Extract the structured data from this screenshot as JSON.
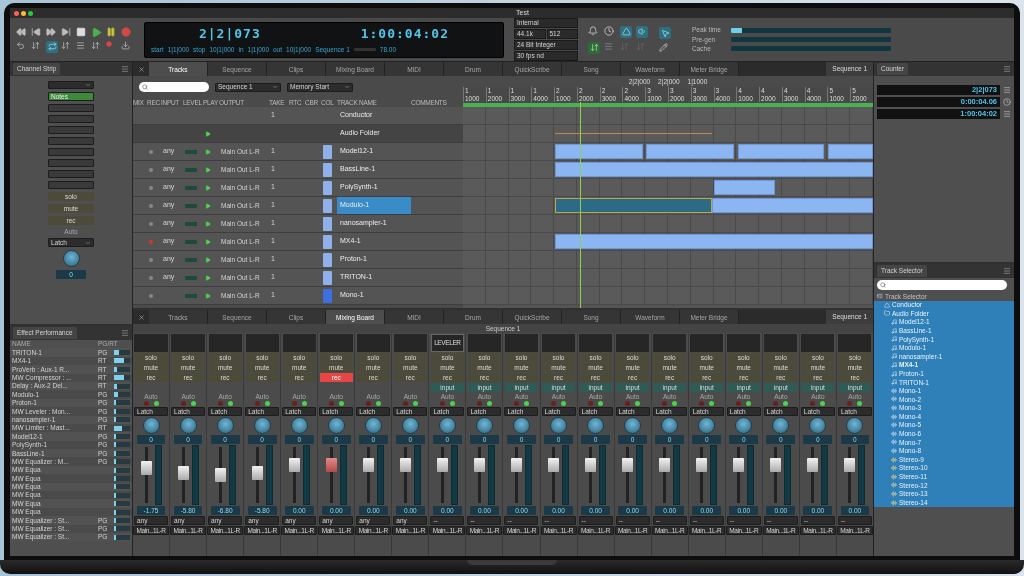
{
  "window": {
    "title": "Test"
  },
  "transport": {
    "position": "2|2|073",
    "timecode": "1:00:04:02",
    "markers": [
      {
        "label": "start",
        "value": "1|1|000"
      },
      {
        "label": "stop",
        "value": "10|1|000"
      },
      {
        "label": "in",
        "value": "1|1|000"
      },
      {
        "label": "out",
        "value": "10|1|000"
      }
    ],
    "sequence": "Sequence 1",
    "tempo": "78.00",
    "engine": [
      [
        "Internal"
      ],
      [
        "44.1k",
        "512"
      ],
      [
        "24 Bit Integer"
      ],
      [
        "30 fps nd"
      ]
    ]
  },
  "status_meters": [
    {
      "label": "Peak time",
      "level": 0.07
    },
    {
      "label": "Pre-gen",
      "level": 0
    },
    {
      "label": "Cache",
      "level": 0
    }
  ],
  "channel_strip": {
    "title": "Channel Strip",
    "notes": "Notes",
    "solo": "solo",
    "mute": "mute",
    "rec": "rec",
    "auto": "Auto",
    "mode": "Latch",
    "pan": "0"
  },
  "top_tabs": [
    {
      "label": "Tracks",
      "selected": true
    },
    {
      "label": "Sequence",
      "selected": false
    },
    {
      "label": "Clips",
      "selected": false
    },
    {
      "label": "Mixing Board",
      "selected": false
    },
    {
      "label": "MIDI",
      "selected": false
    },
    {
      "label": "Drum",
      "selected": false
    },
    {
      "label": "QuickScribe",
      "selected": false
    },
    {
      "label": "Song",
      "selected": false
    },
    {
      "label": "Waveform",
      "selected": false
    },
    {
      "label": "Meter Bridge",
      "selected": false
    }
  ],
  "top_sequence_menu": "Sequence 1",
  "tracks": {
    "sequence": "Sequence 1",
    "memory": "Memory Start",
    "columns": [
      "MIX",
      "REC",
      "INPUT",
      "LEVEL",
      "PLAY",
      "OUTPUT",
      "TAKE",
      "RTC",
      "CBR",
      "COL",
      "TRACK NAME",
      "COMMENTS"
    ],
    "rows": [
      {
        "kind": "conductor",
        "name": "Conductor",
        "take": "1",
        "selected": false
      },
      {
        "kind": "folder",
        "name": "Audio Folder",
        "selected": false
      },
      {
        "kind": "track",
        "name": "Model12-1",
        "input": "any",
        "output": "Main Out L-R",
        "take": "1",
        "rec": false,
        "color": "#8fb0e8",
        "selected": false
      },
      {
        "kind": "track",
        "name": "BassLine-1",
        "input": "any",
        "output": "Main Out L-R",
        "take": "1",
        "rec": false,
        "color": "#8fb0e8",
        "selected": false
      },
      {
        "kind": "track",
        "name": "PolySynth-1",
        "input": "any",
        "output": "Main Out L-R",
        "take": "1",
        "rec": false,
        "color": "#8fb0e8",
        "selected": false
      },
      {
        "kind": "track",
        "name": "Modulo-1",
        "input": "any",
        "output": "Main Out L-R",
        "take": "1",
        "rec": false,
        "color": "#8fb0e8",
        "selected": true
      },
      {
        "kind": "track",
        "name": "nanosampler-1",
        "input": "any",
        "output": "Main Out L-R",
        "take": "1",
        "rec": false,
        "color": "#8fb0e8",
        "selected": false
      },
      {
        "kind": "track",
        "name": "MX4-1",
        "input": "any",
        "output": "Main Out L-R",
        "take": "1",
        "rec": true,
        "color": "#8fb0e8",
        "selected": false
      },
      {
        "kind": "track",
        "name": "Proton-1",
        "input": "any",
        "output": "Main Out L-R",
        "take": "1",
        "rec": false,
        "color": "#8fb0e8",
        "selected": false
      },
      {
        "kind": "track",
        "name": "TRITON-1",
        "input": "any",
        "output": "Main Out L-R",
        "take": "1",
        "rec": false,
        "color": "#8fb0e8",
        "selected": false
      },
      {
        "kind": "track",
        "name": "Mono-1",
        "output": "Main Out L-R",
        "take": "1",
        "rec": false,
        "color": "#3d6fe0",
        "selected": false
      }
    ]
  },
  "timeline": {
    "readouts": [
      "2|2|000",
      "2|2|000",
      "1|1000"
    ],
    "ruler": [
      {
        "bar": "1",
        "tick": "1000"
      },
      {
        "bar": "1",
        "tick": "2000"
      },
      {
        "bar": "1",
        "tick": "3000"
      },
      {
        "bar": "1",
        "tick": "4000"
      },
      {
        "bar": "2",
        "tick": "1000"
      },
      {
        "bar": "2",
        "tick": "2000"
      },
      {
        "bar": "2",
        "tick": "3000"
      },
      {
        "bar": "2",
        "tick": "4000"
      },
      {
        "bar": "3",
        "tick": "1000"
      },
      {
        "bar": "3",
        "tick": "2000"
      },
      {
        "bar": "3",
        "tick": "3000"
      },
      {
        "bar": "3",
        "tick": "4000"
      },
      {
        "bar": "4",
        "tick": "1000"
      },
      {
        "bar": "4",
        "tick": "2000"
      },
      {
        "bar": "4",
        "tick": "3000"
      },
      {
        "bar": "4",
        "tick": "4000"
      },
      {
        "bar": "5",
        "tick": "1000"
      },
      {
        "bar": "5",
        "tick": "2000"
      }
    ]
  },
  "counter": {
    "title": "Counter",
    "readings": [
      "2|2|073",
      "0:00:04.06",
      "1:00:04:02"
    ]
  },
  "effects": {
    "title": "Effect Performance",
    "columns": [
      "NAME",
      "PG/RT"
    ],
    "rows": [
      {
        "name": "TRITON-1",
        "mode": "PG",
        "level": 0.3
      },
      {
        "name": "MX4-1",
        "mode": "RT",
        "level": 0.6
      },
      {
        "name": "ProVerb : Aux-1 R...",
        "mode": "RT",
        "level": 0.2
      },
      {
        "name": "MW Compressor : ...",
        "mode": "RT",
        "level": 0.6
      },
      {
        "name": "Delay : Aux-2 Del...",
        "mode": "RT",
        "level": 0.2
      },
      {
        "name": "Modulo-1",
        "mode": "PG",
        "level": 0.25
      },
      {
        "name": "Proton-1",
        "mode": "PG",
        "level": 0.15
      },
      {
        "name": "MW Leveler : Mon...",
        "mode": "PG",
        "level": 0.15
      },
      {
        "name": "nanosampler-1",
        "mode": "PG",
        "level": 0.15
      },
      {
        "name": "MW Limiter : Mast...",
        "mode": "RT",
        "level": 0.5
      },
      {
        "name": "Model12-1",
        "mode": "PG",
        "level": 0.15
      },
      {
        "name": "PolySynth-1",
        "mode": "PG",
        "level": 0.15
      },
      {
        "name": "BassLine-1",
        "mode": "PG",
        "level": 0.15
      },
      {
        "name": "MW Equalizer : M...",
        "mode": "PG",
        "level": 0.1
      },
      {
        "name": "MW Equa",
        "level": 0.1
      },
      {
        "name": "MW Equa",
        "level": 0.1
      },
      {
        "name": "MW Equa",
        "level": 0.1
      },
      {
        "name": "MW Equa",
        "level": 0.1
      },
      {
        "name": "MW Equa",
        "level": 0.1
      },
      {
        "name": "MW Equa",
        "level": 0.1
      },
      {
        "name": "MW Equalizer : St...",
        "mode": "PG",
        "level": 0.1
      },
      {
        "name": "MW Equalizer : St...",
        "mode": "PG",
        "level": 0.1
      },
      {
        "name": "MW Equalizer : St...",
        "mode": "PG",
        "level": 0.1
      }
    ]
  },
  "bottom_tabs": [
    {
      "label": "Tracks",
      "selected": false
    },
    {
      "label": "Sequence",
      "selected": false
    },
    {
      "label": "Clips",
      "selected": false
    },
    {
      "label": "Mixing Board",
      "selected": true
    },
    {
      "label": "MIDI",
      "selected": false
    },
    {
      "label": "Drum",
      "selected": false
    },
    {
      "label": "QuickScribe",
      "selected": false
    },
    {
      "label": "Song",
      "selected": false
    },
    {
      "label": "Waveform",
      "selected": false
    },
    {
      "label": "Meter Bridge",
      "selected": false
    }
  ],
  "mixer": {
    "sequence_menu": "Sequence 1",
    "title": "Sequence 1",
    "channels": [
      {
        "solo": "solo",
        "mute": "mute",
        "rec": "rec",
        "rec_on": false,
        "auto": "Auto",
        "mode": "Latch",
        "pan": "0",
        "level": 0.66,
        "gain": "-1.75",
        "in": "any",
        "out": "Main...1L-R"
      },
      {
        "solo": "solo",
        "mute": "mute",
        "rec": "rec",
        "rec_on": false,
        "auto": "Auto",
        "mode": "Latch",
        "pan": "0",
        "level": 0.55,
        "gain": "-5.80",
        "in": "any",
        "out": "Main...1L-R"
      },
      {
        "solo": "solo",
        "mute": "mute",
        "rec": "rec",
        "rec_on": false,
        "auto": "Auto",
        "mode": "Latch",
        "pan": "0",
        "level": 0.52,
        "gain": "-6.80",
        "in": "any",
        "out": "Main...1L-R"
      },
      {
        "solo": "solo",
        "mute": "mute",
        "rec": "rec",
        "rec_on": false,
        "auto": "Auto",
        "mode": "Latch",
        "pan": "0",
        "level": 0.55,
        "gain": "-5.80",
        "in": "any",
        "out": "Main...1L-R"
      },
      {
        "solo": "solo",
        "mute": "mute",
        "rec": "rec",
        "rec_on": false,
        "auto": "Auto",
        "mode": "Latch",
        "pan": "0",
        "level": 0.72,
        "gain": "0.00",
        "in": "any",
        "out": "Main...1L-R"
      },
      {
        "solo": "solo",
        "mute": "mute",
        "rec": "rec",
        "rec_on": true,
        "auto": "Auto",
        "mode": "Latch",
        "pan": "0",
        "level": 0.72,
        "gain": "0.00",
        "in": "any",
        "out": "Main...1L-R"
      },
      {
        "solo": "solo",
        "mute": "mute",
        "rec": "rec",
        "rec_on": false,
        "auto": "Auto",
        "mode": "Latch",
        "pan": "0",
        "level": 0.72,
        "gain": "0.00",
        "in": "any",
        "out": "Main...1L-R"
      },
      {
        "solo": "solo",
        "mute": "mute",
        "rec": "rec",
        "rec_on": false,
        "auto": "Auto",
        "mode": "Latch",
        "pan": "0",
        "level": 0.72,
        "gain": "0.00",
        "in": "any",
        "out": "Main...1L-R"
      },
      {
        "plugin": "LEVELER",
        "solo": "solo",
        "mute": "mute",
        "rec": "rec",
        "rec_on": false,
        "input": "input",
        "auto": "Auto",
        "mode": "Latch",
        "pan": "0",
        "level": 0.72,
        "gain": "0.00",
        "in": "--",
        "out": "Main...1L-R"
      },
      {
        "solo": "solo",
        "mute": "mute",
        "rec": "rec",
        "rec_on": false,
        "input": "input",
        "auto": "Auto",
        "mode": "Latch",
        "pan": "0",
        "level": 0.72,
        "gain": "0.00",
        "in": "--",
        "out": "Main...1L-R"
      },
      {
        "solo": "solo",
        "mute": "mute",
        "rec": "rec",
        "rec_on": false,
        "input": "input",
        "auto": "Auto",
        "mode": "Latch",
        "pan": "0",
        "level": 0.72,
        "gain": "0.00",
        "in": "--",
        "out": "Main...1L-R"
      },
      {
        "solo": "solo",
        "mute": "mute",
        "rec": "rec",
        "rec_on": false,
        "input": "input",
        "auto": "Auto",
        "mode": "Latch",
        "pan": "0",
        "level": 0.72,
        "gain": "0.00",
        "in": "--",
        "out": "Main...1L-R"
      },
      {
        "solo": "solo",
        "mute": "mute",
        "rec": "rec",
        "rec_on": false,
        "input": "input",
        "auto": "Auto",
        "mode": "Latch",
        "pan": "0",
        "level": 0.72,
        "gain": "0.00",
        "in": "--",
        "out": "Main...1L-R"
      },
      {
        "solo": "solo",
        "mute": "mute",
        "rec": "rec",
        "rec_on": false,
        "input": "input",
        "auto": "Auto",
        "mode": "Latch",
        "pan": "0",
        "level": 0.72,
        "gain": "0.00",
        "in": "--",
        "out": "Main...1L-R"
      },
      {
        "solo": "solo",
        "mute": "mute",
        "rec": "rec",
        "rec_on": false,
        "input": "input",
        "auto": "Auto",
        "mode": "Latch",
        "pan": "0",
        "level": 0.72,
        "gain": "0.00",
        "in": "--",
        "out": "Main...1L-R"
      },
      {
        "solo": "solo",
        "mute": "mute",
        "rec": "rec",
        "rec_on": false,
        "input": "input",
        "auto": "Auto",
        "mode": "Latch",
        "pan": "0",
        "level": 0.72,
        "gain": "0.00",
        "in": "--",
        "out": "Main...1L-R"
      },
      {
        "solo": "solo",
        "mute": "mute",
        "rec": "rec",
        "rec_on": false,
        "input": "input",
        "auto": "Auto",
        "mode": "Latch",
        "pan": "0",
        "level": 0.72,
        "gain": "0.00",
        "in": "--",
        "out": "Main...1L-R"
      },
      {
        "solo": "solo",
        "mute": "mute",
        "rec": "rec",
        "rec_on": false,
        "input": "input",
        "auto": "Auto",
        "mode": "Latch",
        "pan": "0",
        "level": 0.72,
        "gain": "0.00",
        "in": "--",
        "out": "Main...1L-R"
      },
      {
        "solo": "solo",
        "mute": "mute",
        "rec": "rec",
        "rec_on": false,
        "input": "input",
        "auto": "Auto",
        "mode": "Latch",
        "pan": "0",
        "level": 0.72,
        "gain": "0.00",
        "in": "--",
        "out": "Main...1L-R"
      },
      {
        "solo": "solo",
        "mute": "mute",
        "rec": "rec",
        "rec_on": false,
        "input": "input",
        "auto": "Auto",
        "mode": "Latch",
        "pan": "0",
        "level": 0.72,
        "gain": "0.00",
        "in": "--",
        "out": "Main...1L-R"
      }
    ]
  },
  "track_selector": {
    "title": "Track Selector",
    "tree": [
      {
        "name": "Track Selector",
        "kind": "root",
        "selected": false,
        "current": false,
        "children": [
          {
            "name": "Conductor",
            "kind": "conductor",
            "selected": true,
            "current": false
          },
          {
            "name": "Audio Folder",
            "kind": "folder",
            "selected": true,
            "current": false,
            "children": [
              {
                "name": "Model12-1",
                "kind": "midi",
                "selected": true,
                "current": false
              },
              {
                "name": "BassLine-1",
                "kind": "midi",
                "selected": true,
                "current": false
              },
              {
                "name": "PolySynth-1",
                "kind": "midi",
                "selected": true,
                "current": false
              },
              {
                "name": "Modulo-1",
                "kind": "midi",
                "selected": true,
                "current": false
              },
              {
                "name": "nanosampler-1",
                "kind": "midi",
                "selected": true,
                "current": false
              },
              {
                "name": "MX4-1",
                "kind": "midi",
                "selected": true,
                "current": true
              },
              {
                "name": "Proton-1",
                "kind": "midi",
                "selected": true,
                "current": false
              },
              {
                "name": "TRITON-1",
                "kind": "midi",
                "selected": true,
                "current": false
              },
              {
                "name": "Mono-1",
                "kind": "mono",
                "selected": true,
                "current": false
              },
              {
                "name": "Mono-2",
                "kind": "mono",
                "selected": true,
                "current": false
              },
              {
                "name": "Mono-3",
                "kind": "mono",
                "selected": true,
                "current": false
              },
              {
                "name": "Mono-4",
                "kind": "mono",
                "selected": true,
                "current": false
              },
              {
                "name": "Mono-5",
                "kind": "mono",
                "selected": true,
                "current": false
              },
              {
                "name": "Mono-6",
                "kind": "mono",
                "selected": true,
                "current": false
              },
              {
                "name": "Mono-7",
                "kind": "mono",
                "selected": true,
                "current": false
              },
              {
                "name": "Mono-8",
                "kind": "mono",
                "selected": true,
                "current": false
              },
              {
                "name": "Stereo-9",
                "kind": "stereo",
                "selected": true,
                "current": false
              },
              {
                "name": "Stereo-10",
                "kind": "stereo",
                "selected": true,
                "current": false
              },
              {
                "name": "Stereo-11",
                "kind": "stereo",
                "selected": true,
                "current": false
              },
              {
                "name": "Stereo-12",
                "kind": "stereo",
                "selected": true,
                "current": false
              },
              {
                "name": "Stereo-13",
                "kind": "stereo",
                "selected": true,
                "current": false
              },
              {
                "name": "Stereo-14",
                "kind": "stereo",
                "selected": true,
                "current": false
              }
            ]
          }
        ]
      }
    ]
  }
}
